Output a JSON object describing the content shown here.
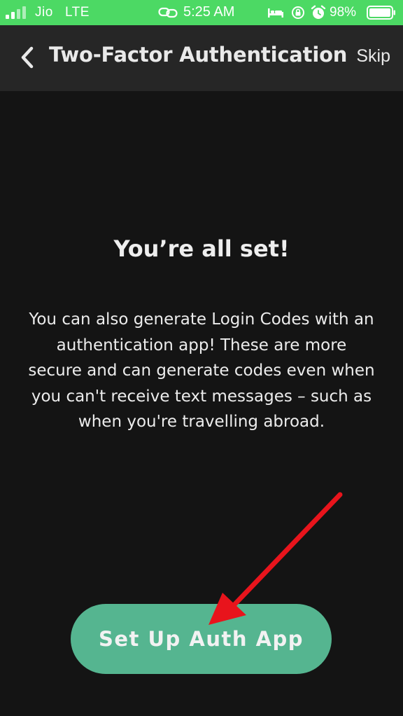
{
  "status_bar": {
    "carrier": "Jio",
    "network": "LTE",
    "time": "5:25 AM",
    "battery_percent": "98%",
    "icons": [
      "signal-icon",
      "link-icon",
      "bed-icon",
      "orientation-lock-icon",
      "alarm-icon",
      "battery-icon"
    ],
    "background_color": "#4cd964"
  },
  "header": {
    "title": "Two-Factor Authentication",
    "skip_label": "Skip",
    "back_icon": "chevron-left-icon",
    "background_color": "#262626"
  },
  "main": {
    "headline": "You’re all set!",
    "description": "You can also generate Login Codes with an authentication app! These are more secure and can generate codes even when you can't receive text messages – such as when you're travelling abroad.",
    "button_label": "Set Up Auth App",
    "button_color": "#55b590",
    "background_color": "#141414"
  },
  "annotation": {
    "icon": "red-arrow-icon",
    "color": "#e8141c"
  }
}
